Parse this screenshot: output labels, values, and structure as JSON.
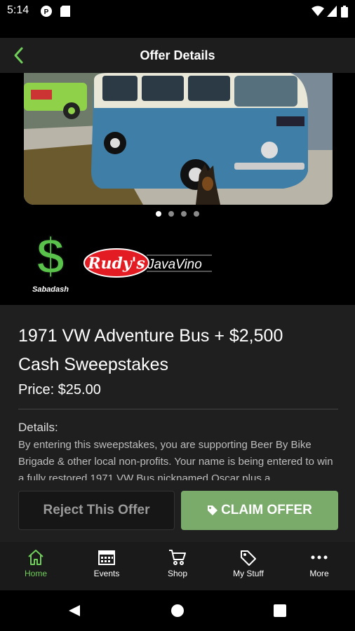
{
  "status_bar": {
    "time": "5:14"
  },
  "header": {
    "title": "Offer Details"
  },
  "carousel": {
    "slides": 4,
    "active_index": 0
  },
  "sponsors": {
    "sabadash_label": "Sabadash",
    "rudys_label": "Rudy's",
    "javavino_label": "JavaVino"
  },
  "offer": {
    "title": "1971 VW Adventure Bus + $2,500 Cash Sweepstakes",
    "price": "Price: $25.00",
    "details_label": "Details:",
    "details_text": "By entering this sweepstakes, you are supporting Beer By Bike Brigade & other local non-profits. Your name is being entered to win a fully restored 1971 VW Bus nicknamed Oscar plus a"
  },
  "actions": {
    "reject_label": "Reject This Offer",
    "claim_label": "CLAIM OFFER"
  },
  "nav": {
    "items": [
      {
        "label": "Home",
        "icon": "home-icon"
      },
      {
        "label": "Events",
        "icon": "calendar-icon"
      },
      {
        "label": "Shop",
        "icon": "cart-icon"
      },
      {
        "label": "My Stuff",
        "icon": "tag-icon"
      },
      {
        "label": "More",
        "icon": "more-icon"
      }
    ]
  },
  "colors": {
    "accent": "#6fcf5a",
    "claim_button": "#7aab6b",
    "panel": "#1f1f1f"
  }
}
